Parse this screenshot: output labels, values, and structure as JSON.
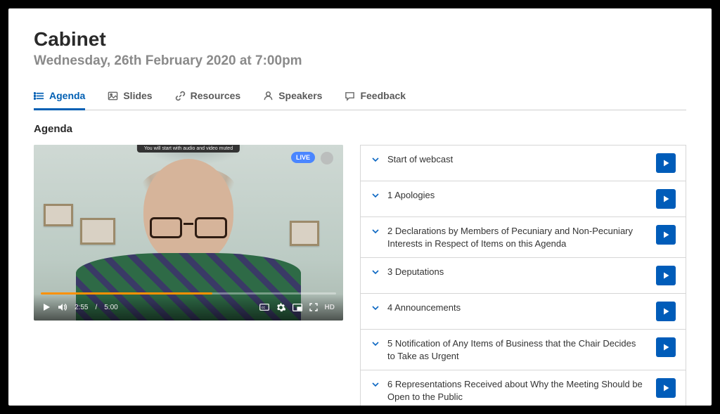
{
  "header": {
    "title": "Cabinet",
    "subtitle": "Wednesday, 26th February 2020 at 7:00pm"
  },
  "tabs": [
    {
      "id": "agenda",
      "label": "Agenda",
      "icon": "list-icon",
      "active": true
    },
    {
      "id": "slides",
      "label": "Slides",
      "icon": "image-icon",
      "active": false
    },
    {
      "id": "resources",
      "label": "Resources",
      "icon": "link-icon",
      "active": false
    },
    {
      "id": "speakers",
      "label": "Speakers",
      "icon": "person-icon",
      "active": false
    },
    {
      "id": "feedback",
      "label": "Feedback",
      "icon": "chat-icon",
      "active": false
    }
  ],
  "section_title": "Agenda",
  "video": {
    "live_label": "LIVE",
    "tip_text": "You will start with audio and video muted",
    "time_current": "2:55",
    "time_separator": "/",
    "time_total": "5:00",
    "hd_label": "HD",
    "progress_pct": 58
  },
  "agenda_items": [
    {
      "label": "Start of webcast"
    },
    {
      "label": "1 Apologies"
    },
    {
      "label": "2 Declarations by Members of Pecuniary and Non-Pecuniary Interests in Respect of Items on this Agenda"
    },
    {
      "label": "3 Deputations"
    },
    {
      "label": "4 Announcements"
    },
    {
      "label": "5 Notification of Any Items of Business that the Chair Decides to Take as Urgent"
    },
    {
      "label": "6 Representations Received about Why the Meeting Should be Open to the Public"
    }
  ],
  "colors": {
    "accent": "#005fb3",
    "play_btn": "#005cb9"
  }
}
